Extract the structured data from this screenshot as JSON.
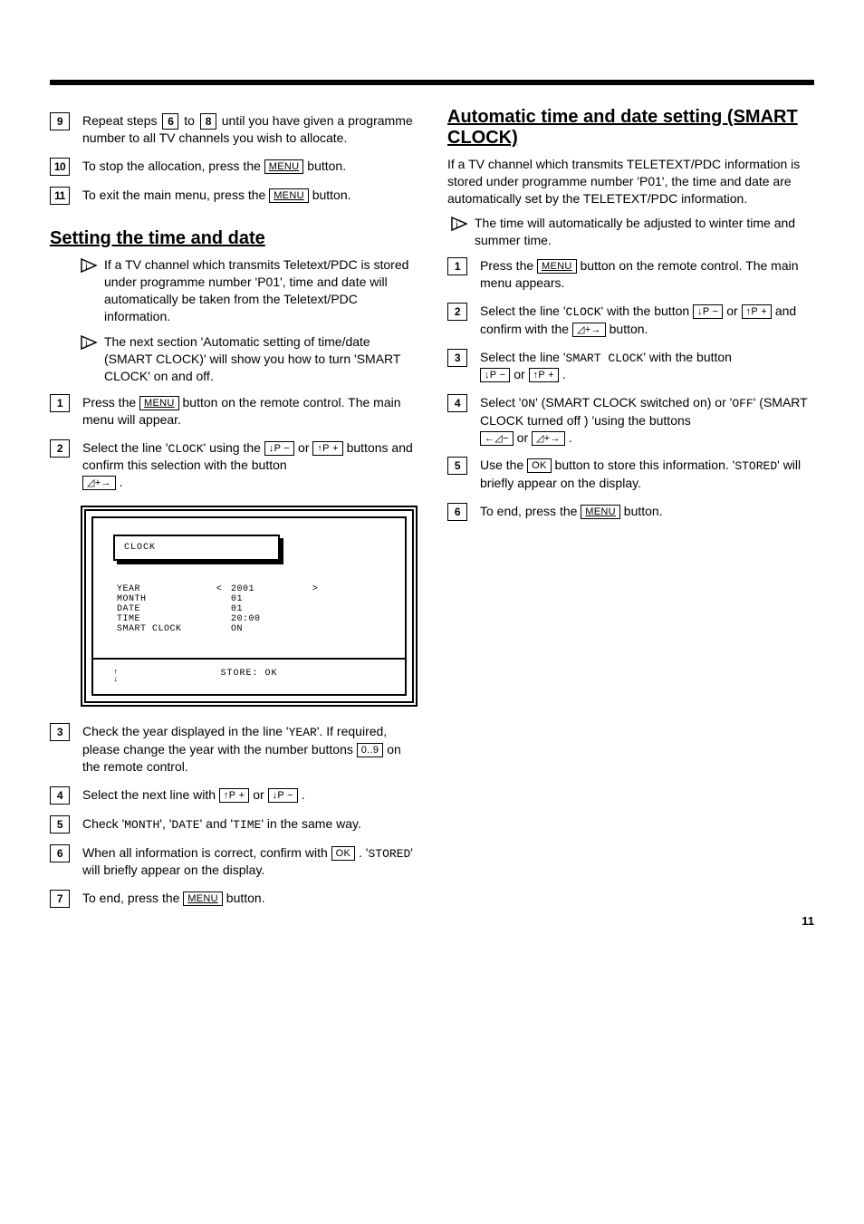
{
  "left": {
    "step9": {
      "n": "9",
      "t1": "Repeat steps ",
      "b1": "6",
      "t2": " to ",
      "b2": "8",
      "t3": " until you have given a programme number to all TV channels you wish to allocate."
    },
    "step10": {
      "n": "10",
      "t1": "To stop the allocation, press the ",
      "b1": "MENU",
      "t2": " button."
    },
    "step11": {
      "n": "11",
      "t1": "To exit the main menu, press the ",
      "b1": "MENU",
      "t2": " button."
    },
    "sec1_title": "Setting the time and date",
    "info1": "If a TV channel which transmits Teletext/PDC is stored under programme number 'P01', time and date will automatically be taken from the Teletext/PDC information.",
    "info2": "The next section 'Automatic setting of time/date (SMART CLOCK)' will show you how to turn 'SMART CLOCK' on and off.",
    "s1": {
      "n": "1",
      "t1": "Press the ",
      "b1": "MENU",
      "t2": " button on the remote control. The main menu will appear."
    },
    "s2": {
      "n": "2",
      "t1": "Select the line '",
      "m1": "CLOCK",
      "t2": "' using the ",
      "b1": "↓P −",
      "t3": " or ",
      "b2": "↑P +",
      "t4": " buttons and confirm this selection with the button ",
      "b3": "◿+→",
      "t5": " ."
    },
    "osd": {
      "title": "CLOCK",
      "rows": [
        {
          "lab": "YEAR",
          "al": "<",
          "val": "2001",
          "ar": ">"
        },
        {
          "lab": "MONTH",
          "al": "",
          "val": "01",
          "ar": ""
        },
        {
          "lab": "DATE",
          "al": "",
          "val": "01",
          "ar": ""
        },
        {
          "lab": "TIME",
          "al": "",
          "val": "20:00",
          "ar": ""
        },
        {
          "lab": "SMART CLOCK",
          "al": "",
          "val": "ON",
          "ar": ""
        }
      ],
      "foot": "STORE: OK"
    },
    "s3": {
      "n": "3",
      "t1": "Check the year displayed in the line '",
      "m1": "YEAR",
      "t2": "'. If required, please change the year with the number buttons ",
      "b1": "0..9",
      "t3": " on the remote control."
    },
    "s4": {
      "n": "4",
      "t1": "Select the next line with ",
      "b1": "↑P +",
      "t2": " or ",
      "b2": "↓P −",
      "t3": " ."
    },
    "s5": {
      "n": "5",
      "t1": "Check '",
      "m1": "MONTH",
      "t2": "', '",
      "m2": "DATE",
      "t3": "' and '",
      "m3": "TIME",
      "t4": "' in the same way."
    },
    "s6": {
      "n": "6",
      "t1": "When all information is correct, confirm with ",
      "b1": "OK",
      "t2": " . '",
      "m1": "STORED",
      "t3": "' will briefly appear on the display."
    },
    "s7": {
      "n": "7",
      "t1": "To end, press the ",
      "b1": "MENU",
      "t2": " button."
    }
  },
  "right": {
    "sec_title": "Automatic time and date setting (SMART CLOCK)",
    "intro": "If a TV channel which transmits TELETEXT/PDC information is stored under programme number 'P01', the time and date are automatically set by the TELETEXT/PDC information.",
    "info": "The time will automatically be adjusted to winter time and summer time.",
    "s1": {
      "n": "1",
      "t1": "Press the ",
      "b1": "MENU",
      "t2": " button on the remote control. The main menu appears."
    },
    "s2": {
      "n": "2",
      "t1": "Select the line '",
      "m1": "CLOCK",
      "t2": "' with the button ",
      "b1": "↓P −",
      "t3": " or ",
      "b2": "↑P +",
      "t4": " and confirm with the ",
      "b3": "◿+→",
      "t5": " button."
    },
    "s3": {
      "n": "3",
      "t1": "Select the line '",
      "m1": "SMART  CLOCK",
      "t2": "' with the button ",
      "b1": "↓P −",
      "t3": " or ",
      "b2": "↑P +",
      "t4": " ."
    },
    "s4": {
      "n": "4",
      "t1": "Select '",
      "m1": "ON",
      "t2": "' (SMART CLOCK switched on) or '",
      "m2": "OFF",
      "t3": "' (SMART CLOCK turned off ) 'using the buttons ",
      "b1": "←◿−",
      "t4": " or ",
      "b2": "◿+→",
      "t5": " ."
    },
    "s5": {
      "n": "5",
      "t1": "Use the ",
      "b1": "OK",
      "t2": " button to store this information. '",
      "m1": "STORED",
      "t3": "' will briefly appear on the display."
    },
    "s6": {
      "n": "6",
      "t1": "To end, press the ",
      "b1": "MENU",
      "t2": " button."
    }
  },
  "page_number": "11"
}
